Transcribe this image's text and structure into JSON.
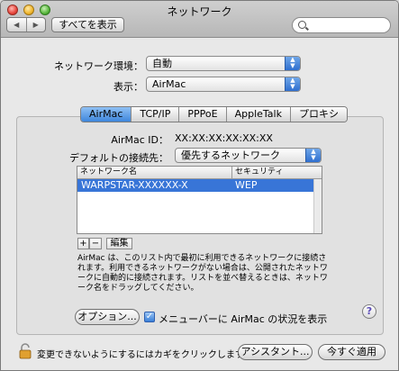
{
  "window": {
    "title": "ネットワーク"
  },
  "toolbar": {
    "back": "◀",
    "forward": "▶",
    "show_all_label": "すべてを表示",
    "search_placeholder": ""
  },
  "location": {
    "label": "ネットワーク環境：",
    "value": "自動"
  },
  "show": {
    "label": "表示：",
    "value": "AirMac"
  },
  "tabs": [
    {
      "label": "AirMac",
      "active": true
    },
    {
      "label": "TCP/IP"
    },
    {
      "label": "PPPoE"
    },
    {
      "label": "AppleTalk"
    },
    {
      "label": "プロキシ"
    }
  ],
  "airmac_id": {
    "label": "AirMac ID：",
    "value": "XX:XX:XX:XX:XX:XX"
  },
  "default_connection": {
    "label": "デフォルトの接続先：",
    "value": "優先するネットワーク"
  },
  "network_table": {
    "columns": [
      "ネットワーク名",
      "セキュリティ"
    ],
    "rows": [
      {
        "name": "WARPSTAR-XXXXXX-X",
        "security": "WEP"
      }
    ]
  },
  "list_buttons": {
    "add": "+",
    "remove": "−",
    "edit": "編集"
  },
  "description": "AirMac は、このリスト内で最初に利用できるネットワークに接続されます。利用できるネットワークがない場合は、公開されたネットワークに自動的に接続されます。リストを並べ替えるときは、ネットワーク名をドラッグしてください。",
  "options_button": "オプション...",
  "menubar_checkbox": {
    "label": "メニューバーに AirMac の状況を表示",
    "checked": true,
    "mark": "✓"
  },
  "help": "?",
  "footer": {
    "lock_text": "変更できないようにするにはカギをクリックします。",
    "assistant_button": "アシスタント...",
    "apply_button": "今すぐ適用"
  },
  "colors": {
    "selection": "#3875d7",
    "accent": "#3e86dc"
  },
  "icons": [
    "close-button",
    "minimize-button",
    "zoom-button",
    "search-icon",
    "help-icon",
    "lock-icon",
    "checkbox-check-icon"
  ]
}
